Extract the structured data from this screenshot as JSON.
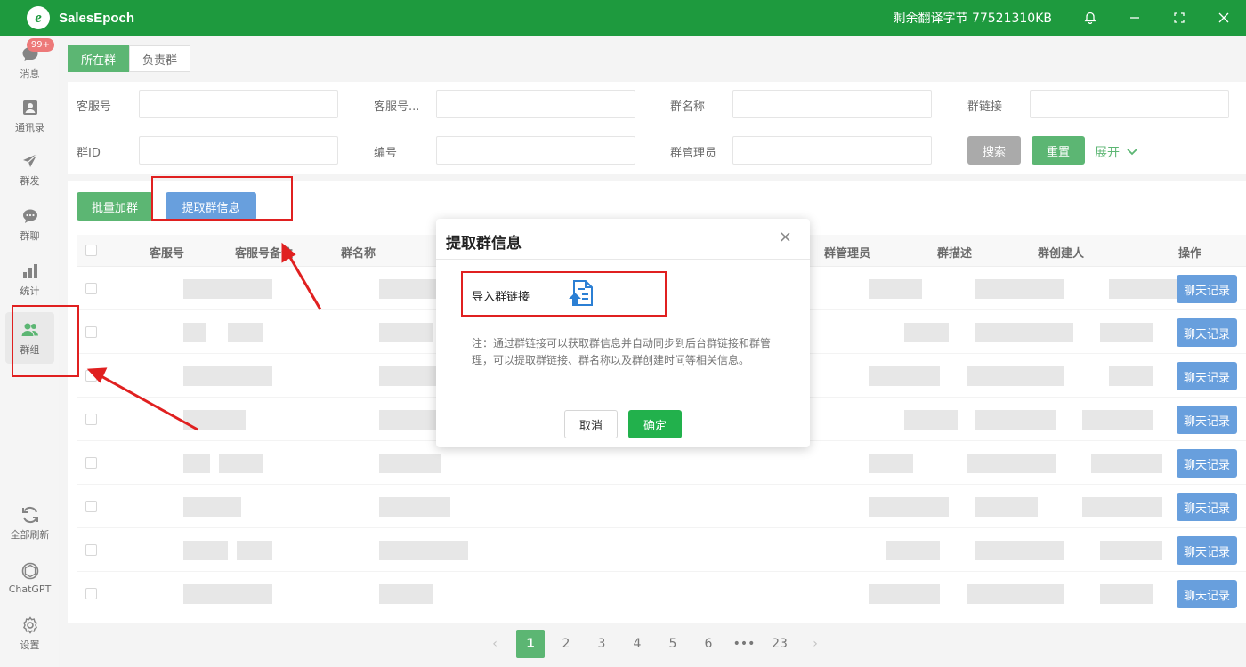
{
  "app": {
    "title": "SalesEpoch",
    "logo_letter": "e",
    "credit": "剩余翻译字节 77521310KB"
  },
  "sidebar": {
    "items": [
      {
        "label": "消息",
        "badge": "99+"
      },
      {
        "label": "通讯录"
      },
      {
        "label": "群发"
      },
      {
        "label": "群聊"
      },
      {
        "label": "统计"
      },
      {
        "label": "群组"
      },
      {
        "label": "全部刷新"
      },
      {
        "label": "ChatGPT"
      },
      {
        "label": "设置"
      }
    ]
  },
  "tabs": [
    {
      "label": "所在群"
    },
    {
      "label": "负责群"
    }
  ],
  "filters": {
    "service_no": "客服号",
    "service_no_more": "客服号...",
    "group_name": "群名称",
    "group_link": "群链接",
    "group_id": "群ID",
    "number": "编号",
    "group_admin": "群管理员",
    "search_btn": "搜索",
    "reset_btn": "重置",
    "expand": "展开"
  },
  "actions": {
    "batch_join": "批量加群",
    "extract_info": "提取群信息"
  },
  "table": {
    "columns": [
      "客服号",
      "客服号备注",
      "群名称",
      "群管理员",
      "群描述",
      "群创建人",
      "操作"
    ],
    "row_action": "聊天记录"
  },
  "pagination": {
    "pages": [
      "1",
      "2",
      "3",
      "4",
      "5",
      "6",
      "•••",
      "23"
    ],
    "current": "1",
    "prev": "‹",
    "next": "›"
  },
  "modal": {
    "title": "提取群信息",
    "close": "×",
    "import_label": "导入群链接",
    "note": "注：通过群链接可以获取群信息并自动同步到后台群链接和群管理，可以提取群链接、群名称以及群创建时间等相关信息。",
    "cancel": "取消",
    "confirm": "确定"
  },
  "colors": {
    "brand": "#1e9a3e",
    "blue": "#2f7bd0",
    "annotation": "#e02020"
  }
}
